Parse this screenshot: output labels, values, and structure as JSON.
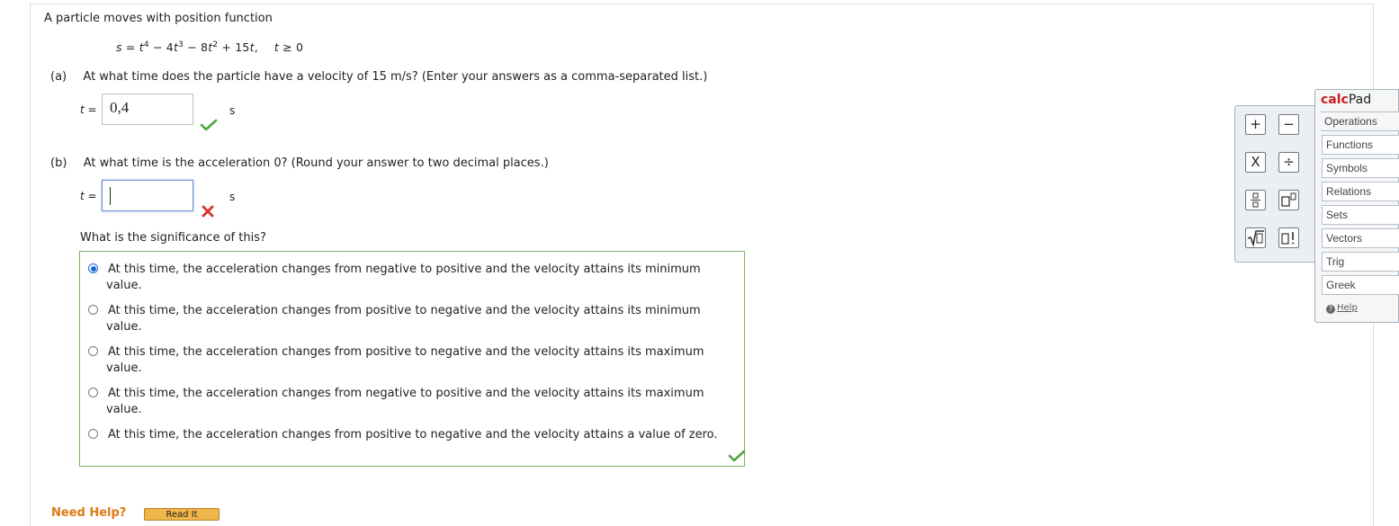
{
  "problem": {
    "intro": "A particle moves with position function",
    "equation": {
      "s_eq": "s = ",
      "t1": "t",
      "exp4": "4",
      "term2": " − 4",
      "t2": "t",
      "exp3": "3",
      "term3": " − 8",
      "t3": "t",
      "exp2": "2",
      "term4": " + 15",
      "t4": "t",
      "comma": ",",
      "condition_t": "t",
      "condition": " ≥ 0"
    }
  },
  "part_a": {
    "label": "(a)",
    "question": "At what time does the particle have a velocity of 15 m/s? (Enter your answers as a comma-separated list.)",
    "var_label": "t =",
    "answer_value": "0,4",
    "unit": "s",
    "status": "correct"
  },
  "part_b": {
    "label": "(b)",
    "question": "At what time is the acceleration 0? (Round your answer to two decimal places.)",
    "var_label": "t =",
    "answer_value": "",
    "unit": "s",
    "status": "incorrect",
    "significance_question": "What is the significance of this?",
    "choices": [
      {
        "line1": "At this time, the acceleration changes from negative to positive and the velocity attains its minimum",
        "line2": "value.",
        "selected": true
      },
      {
        "line1": "At this time, the acceleration changes from positive to negative and the velocity attains its minimum",
        "line2": "value.",
        "selected": false
      },
      {
        "line1": "At this time, the acceleration changes from positive to negative and the velocity attains its maximum",
        "line2": "value.",
        "selected": false
      },
      {
        "line1": "At this time, the acceleration changes from negative to positive and the velocity attains its maximum",
        "line2": "value.",
        "selected": false
      },
      {
        "line1": "At this time, the acceleration changes from positive to negative and the velocity attains a value of zero.",
        "line2": "",
        "selected": false
      }
    ],
    "choices_status": "correct"
  },
  "calc_buttons": {
    "plus": "+",
    "minus": "−",
    "times": "X",
    "divide": "÷",
    "fraction": "▫⁄▫",
    "superscript": "▫▫",
    "sqrt": "√▫",
    "factorial": "▫!"
  },
  "calcpad": {
    "title_calc": "calc",
    "title_pad": "Pad",
    "menu": [
      "Operations",
      "Functions",
      "Symbols",
      "Relations",
      "Sets",
      "Vectors",
      "Trig",
      "Greek"
    ],
    "active_menu": "Operations",
    "help": "Help"
  },
  "footer": {
    "need_help": "Need Help?",
    "read_it": "Read It"
  },
  "colors": {
    "correct": "#4aa83a",
    "incorrect": "#d9312c",
    "radio_selected": "#1a66d6",
    "calcpad_red": "#cc1f1f"
  }
}
